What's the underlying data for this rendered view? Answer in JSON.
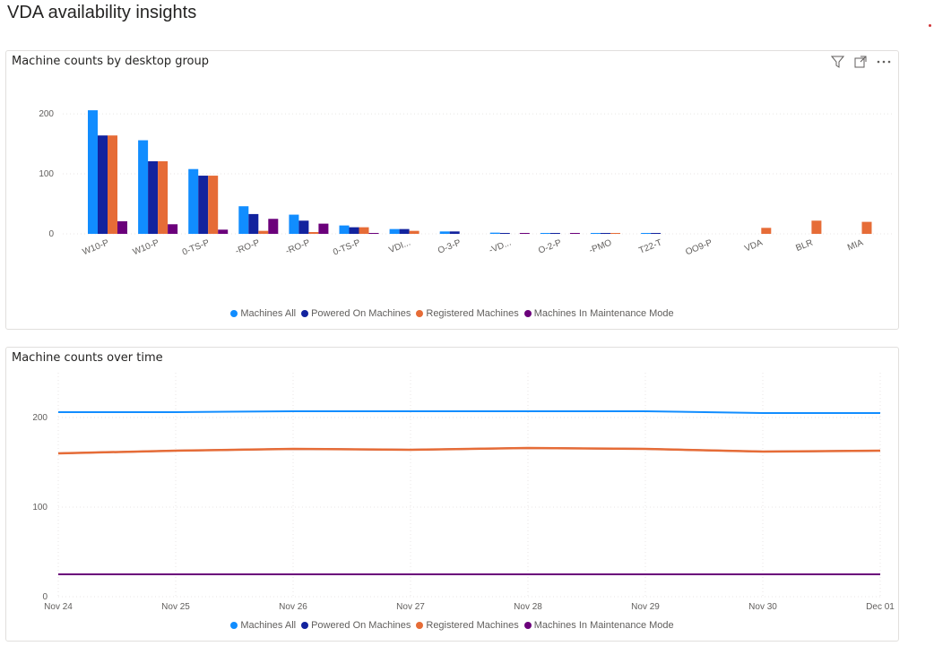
{
  "page": {
    "title": "VDA availability insights"
  },
  "colors": {
    "machines_all": "#118DFF",
    "powered_on": "#12239E",
    "registered": "#E66C37",
    "maintenance": "#6B007B"
  },
  "icons": [
    "filter-icon",
    "focus-mode-icon",
    "more-options-icon"
  ],
  "chart_data": [
    {
      "type": "bar",
      "title": "Machine counts by desktop group",
      "xlabel": "",
      "ylabel": "",
      "ylim": [
        0,
        230
      ],
      "yticks": [
        0,
        100,
        200
      ],
      "grid": true,
      "legend_position": "bottom-center",
      "categories": [
        "W10-P",
        "W10-P",
        "0-TS-P",
        "-RO-P",
        "-RO-P",
        "0-TS-P",
        "VDI...",
        "O-3-P",
        "-VD...",
        "O-2-P",
        "-PMO",
        "T22-T",
        "OO9-P",
        "VDA",
        "BLR",
        "MIA"
      ],
      "series": [
        {
          "name": "Machines All",
          "values": [
            206,
            156,
            108,
            46,
            32,
            14,
            8,
            4,
            2,
            1,
            1,
            1,
            0,
            0,
            0,
            0
          ]
        },
        {
          "name": "Powered On Machines",
          "values": [
            164,
            121,
            97,
            33,
            22,
            11,
            8,
            4,
            1,
            1,
            1,
            1,
            0,
            0,
            0,
            0
          ]
        },
        {
          "name": "Registered Machines",
          "values": [
            164,
            121,
            97,
            5,
            3,
            11,
            5,
            0,
            0,
            0,
            1,
            0,
            0,
            10,
            22,
            20
          ]
        },
        {
          "name": "Machines In Maintenance Mode",
          "values": [
            21,
            16,
            7,
            25,
            17,
            1,
            0,
            0,
            1,
            1,
            0,
            0,
            0,
            0,
            0,
            0
          ]
        }
      ]
    },
    {
      "type": "line",
      "title": "Machine counts over time",
      "xlabel": "",
      "ylabel": "",
      "ylim": [
        0,
        250
      ],
      "yticks": [
        0,
        100,
        200
      ],
      "grid": true,
      "legend_position": "bottom-center",
      "x": [
        "Nov 24",
        "Nov 25",
        "Nov 26",
        "Nov 27",
        "Nov 28",
        "Nov 29",
        "Nov 30",
        "Dec 01"
      ],
      "series": [
        {
          "name": "Machines All",
          "values": [
            206,
            206,
            207,
            207,
            207,
            207,
            205,
            205
          ]
        },
        {
          "name": "Powered On Machines",
          "values": [
            160,
            163,
            165,
            164,
            166,
            165,
            162,
            163
          ]
        },
        {
          "name": "Registered Machines",
          "values": [
            160,
            163,
            165,
            164,
            166,
            165,
            162,
            163
          ]
        },
        {
          "name": "Machines In Maintenance Mode",
          "values": [
            25,
            25,
            25,
            25,
            25,
            25,
            25,
            25
          ]
        }
      ]
    }
  ]
}
